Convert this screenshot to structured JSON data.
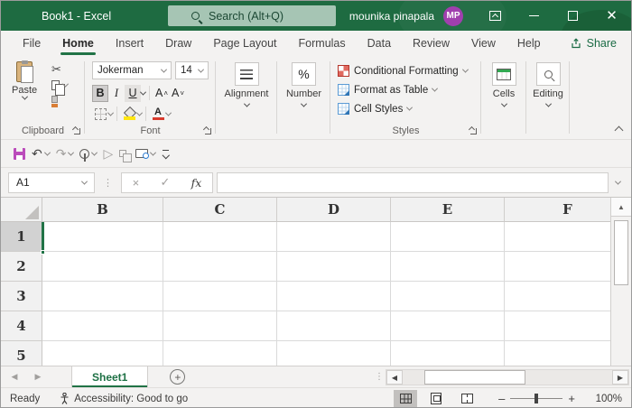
{
  "colors": {
    "accent_green": "#217346",
    "titlebar_green": "#1e6b41",
    "avatar_purple": "#a03fae",
    "save_purple": "#bb4cbb",
    "fill_yellow": "#ffe612",
    "font_color_red": "#d83b2d"
  },
  "title_bar": {
    "title": "Book1 - Excel",
    "search_placeholder": "Search (Alt+Q)",
    "user_name": "mounika pinapala",
    "avatar_initials": "MP"
  },
  "menu": {
    "tabs": [
      {
        "label": "File"
      },
      {
        "label": "Home",
        "active": true
      },
      {
        "label": "Insert"
      },
      {
        "label": "Draw"
      },
      {
        "label": "Page Layout"
      },
      {
        "label": "Formulas"
      },
      {
        "label": "Data"
      },
      {
        "label": "Review"
      },
      {
        "label": "View"
      },
      {
        "label": "Help"
      }
    ],
    "share_label": "Share"
  },
  "ribbon": {
    "clipboard": {
      "group_label": "Clipboard",
      "paste_label": "Paste"
    },
    "font": {
      "group_label": "Font",
      "font_name": "Jokerman",
      "font_size": "14",
      "bold": "B",
      "italic": "I",
      "underline": "U",
      "grow_font": "A",
      "shrink_font": "A"
    },
    "alignment": {
      "group_label": "Alignment"
    },
    "number": {
      "group_label": "Number",
      "percent_symbol": "%"
    },
    "styles": {
      "group_label": "Styles",
      "conditional_formatting": "Conditional Formatting",
      "format_as_table": "Format as Table",
      "cell_styles": "Cell Styles"
    },
    "cells": {
      "group_label": "Cells"
    },
    "editing": {
      "group_label": "Editing"
    }
  },
  "qat": {
    "icons": [
      "save",
      "undo",
      "redo",
      "touch-mouse-mode",
      "send",
      "reuse-files",
      "screen-clipping",
      "customize-quick-access-toolbar"
    ],
    "glyphs": {
      "undo": "↶",
      "redo": "↷",
      "cut": "✂",
      "send": "▷"
    }
  },
  "formula_bar": {
    "name_box_value": "A1",
    "cancel_glyph": "×",
    "enter_glyph": "✓",
    "insert_function_label": "fx",
    "formula_value": ""
  },
  "grid": {
    "selected_cell": "A1",
    "column_headers": [
      "B",
      "C",
      "D",
      "E",
      "F"
    ],
    "row_headers": [
      "1",
      "2",
      "3",
      "4",
      "5"
    ]
  },
  "sheet_bar": {
    "sheets": [
      {
        "label": "Sheet1",
        "active": true
      }
    ],
    "add_sheet_glyph": "+"
  },
  "status_bar": {
    "ready_label": "Ready",
    "accessibility_label": "Accessibility: Good to go",
    "zoom_out_glyph": "–",
    "zoom_in_glyph": "+",
    "zoom_level": "100%"
  }
}
